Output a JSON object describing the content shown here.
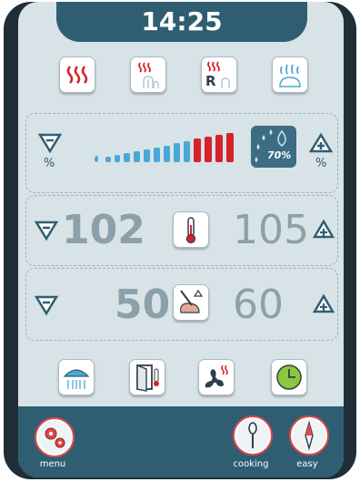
{
  "clock": {
    "time": "14:25"
  },
  "top_modes": [
    {
      "icon": "dry-heat-icon"
    },
    {
      "icon": "combi-steam-icon"
    },
    {
      "icon": "regeneration-icon",
      "label": "R"
    },
    {
      "icon": "steam-icon"
    }
  ],
  "humidity": {
    "percent_label_left": "%",
    "percent_label_right": "%",
    "bar_level": 0.7,
    "bars_total": 13,
    "bars_active_red": 4,
    "readout": "70%",
    "colors": {
      "blue": "#4aa8d8",
      "red": "#d6222a"
    }
  },
  "temperature": {
    "set_value": "102",
    "actual_value": "105"
  },
  "core_probe": {
    "set_value": "50",
    "actual_value": "60"
  },
  "bottom_tools": [
    {
      "icon": "shower-icon"
    },
    {
      "icon": "door-temp-icon"
    },
    {
      "icon": "fan-speed-icon"
    },
    {
      "icon": "timer-clock-icon"
    }
  ],
  "nav": {
    "menu_label": "menu",
    "cooking_label": "cooking",
    "easy_label": "easy"
  },
  "colors": {
    "accent": "#2f5e73",
    "screen": "#d8e3e8",
    "heat_red": "#d6222a"
  }
}
